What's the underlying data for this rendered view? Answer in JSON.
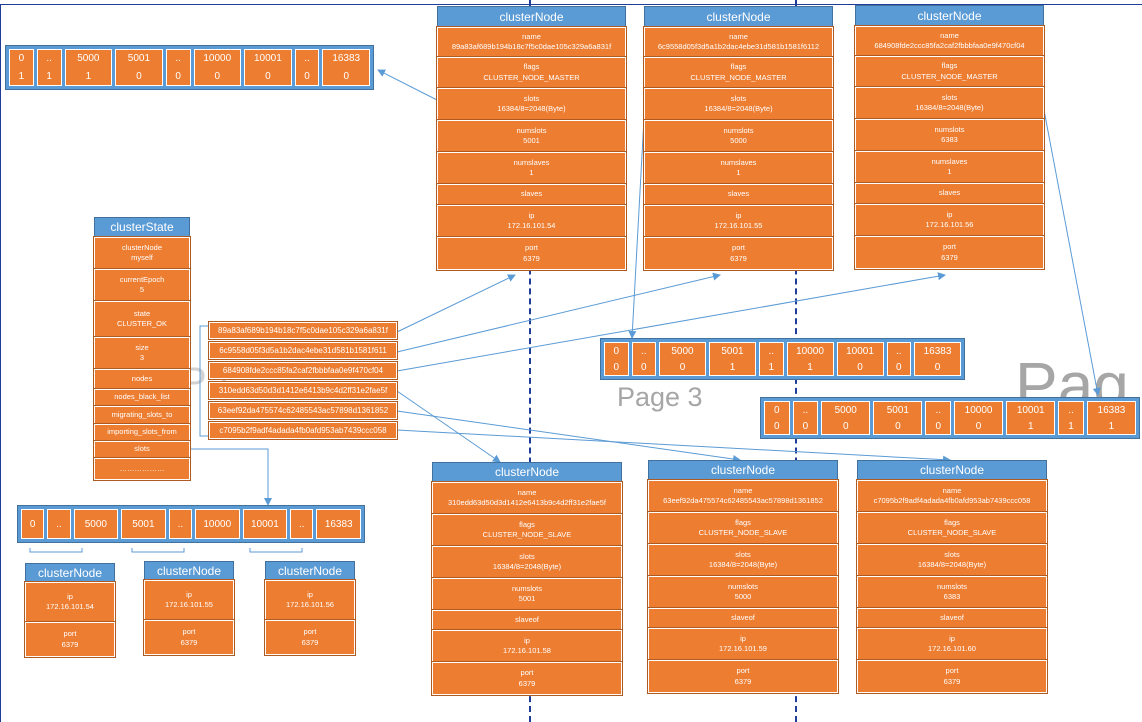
{
  "colors": {
    "header": "#5b9bd5",
    "field": "#ed7d31",
    "line": "#5b9bd5",
    "divider": "#1f3c99"
  },
  "watermarks": {
    "page3": "Page 3",
    "page_right": "Pag",
    "page_left": "Pa"
  },
  "masters": [
    {
      "title": "clusterNode",
      "fields": [
        [
          "name",
          "89a83af689b194b18c7f5c0dae105c329a6a831f"
        ],
        [
          "flags",
          "CLUSTER_NODE_MASTER"
        ],
        [
          "slots",
          "16384/8=2048(Byte)"
        ],
        [
          "numslots",
          "5001"
        ],
        [
          "numslaves",
          "1"
        ],
        [
          "slaves",
          ""
        ],
        [
          "ip",
          "172.16.101.54"
        ],
        [
          "port",
          "6379"
        ]
      ]
    },
    {
      "title": "clusterNode",
      "fields": [
        [
          "name",
          "6c9558d05f3d5a1b2dac4ebe31d581b1581f6112"
        ],
        [
          "flags",
          "CLUSTER_NODE_MASTER"
        ],
        [
          "slots",
          "16384/8=2048(Byte)"
        ],
        [
          "numslots",
          "5000"
        ],
        [
          "numslaves",
          "1"
        ],
        [
          "slaves",
          ""
        ],
        [
          "ip",
          "172.16.101.55"
        ],
        [
          "port",
          "6379"
        ]
      ]
    },
    {
      "title": "clusterNode",
      "fields": [
        [
          "name",
          "684908fde2ccc85fa2caf2fbbbfaa0e9f470cf04"
        ],
        [
          "flags",
          "CLUSTER_NODE_MASTER"
        ],
        [
          "slots",
          "16384/8=2048(Byte)"
        ],
        [
          "numslots",
          "6383"
        ],
        [
          "numslaves",
          "1"
        ],
        [
          "slaves",
          ""
        ],
        [
          "ip",
          "172.16.101.56"
        ],
        [
          "port",
          "6379"
        ]
      ]
    }
  ],
  "slaves": [
    {
      "title": "clusterNode",
      "fields": [
        [
          "name",
          "310edd63d50d3d1412e6413b9c4d2ff31e2fae5f"
        ],
        [
          "flags",
          "CLUSTER_NODE_SLAVE"
        ],
        [
          "slots",
          "16384/8=2048(Byte)"
        ],
        [
          "numslots",
          "5001"
        ],
        [
          "slaveof",
          ""
        ],
        [
          "ip",
          "172.16.101.58"
        ],
        [
          "port",
          "6379"
        ]
      ]
    },
    {
      "title": "clusterNode",
      "fields": [
        [
          "name",
          "63eef92da475574c62485543ac57898d1361852"
        ],
        [
          "flags",
          "CLUSTER_NODE_SLAVE"
        ],
        [
          "slots",
          "16384/8=2048(Byte)"
        ],
        [
          "numslots",
          "5000"
        ],
        [
          "slaveof",
          ""
        ],
        [
          "ip",
          "172.16.101.59"
        ],
        [
          "port",
          "6379"
        ]
      ]
    },
    {
      "title": "clusterNode",
      "fields": [
        [
          "name",
          "c7095b2f9adf4adada4fb0afd953ab7439ccc058"
        ],
        [
          "flags",
          "CLUSTER_NODE_SLAVE"
        ],
        [
          "slots",
          "16384/8=2048(Byte)"
        ],
        [
          "numslots",
          "6383"
        ],
        [
          "slaveof",
          ""
        ],
        [
          "ip",
          "172.16.101.60"
        ],
        [
          "port",
          "6379"
        ]
      ]
    }
  ],
  "state": {
    "title": "clusterState",
    "fields": [
      [
        "clusterNode",
        "myself"
      ],
      [
        "currentEpoch",
        "5"
      ],
      [
        "state",
        "CLUSTER_OK"
      ],
      [
        "size",
        "3"
      ],
      [
        "nodes",
        ""
      ],
      [
        "nodes_black_list",
        ""
      ],
      [
        "migrating_slots_to",
        ""
      ],
      [
        "importing_slots_from",
        ""
      ],
      [
        "slots",
        ""
      ],
      [
        "………………",
        ""
      ]
    ]
  },
  "dict": [
    "89a83af689b194b18c7f5c0dae105c329a6a831f",
    "6c9558d05f3d5a1b2dac4ebe31d581b1581f611",
    "684908fde2ccc85fa2caf2fbbbfaa0e9f470cf04",
    "310edd63d50d3d1412e6413b9c4d2ff31e2fae5f",
    "63eef92da475574c62485543ac57898d1361852",
    "c7095b2f9adf4adada4fb0afd953ab7439ccc058"
  ],
  "bitmaps": [
    {
      "idx": [
        "0",
        "..",
        "5000",
        "5001",
        "..",
        "10000",
        "10001",
        "..",
        "16383"
      ],
      "bits": [
        "1",
        "1",
        "1",
        "0",
        "0",
        "0",
        "0",
        "0",
        "0"
      ]
    },
    {
      "idx": [
        "0",
        "..",
        "5000",
        "5001",
        "..",
        "10000",
        "10001",
        "..",
        "16383"
      ],
      "bits": [
        "0",
        "0",
        "0",
        "1",
        "1",
        "1",
        "0",
        "0",
        "0"
      ]
    },
    {
      "idx": [
        "0",
        "..",
        "5000",
        "5001",
        "..",
        "10000",
        "10001",
        "..",
        "16383"
      ],
      "bits": [
        "0",
        "0",
        "0",
        "0",
        "0",
        "0",
        "1",
        "1",
        "1"
      ]
    }
  ],
  "slot_array": [
    "0",
    "..",
    "5000",
    "5001",
    "..",
    "10000",
    "10001",
    "..",
    "16383"
  ],
  "small_nodes": [
    {
      "title": "clusterNode",
      "fields": [
        [
          "ip",
          "172.16.101.54"
        ],
        [
          "port",
          "6379"
        ]
      ]
    },
    {
      "title": "clusterNode",
      "fields": [
        [
          "ip",
          "172.16.101.55"
        ],
        [
          "port",
          "6379"
        ]
      ]
    },
    {
      "title": "clusterNode",
      "fields": [
        [
          "ip",
          "172.16.101.56"
        ],
        [
          "port",
          "6379"
        ]
      ]
    }
  ]
}
